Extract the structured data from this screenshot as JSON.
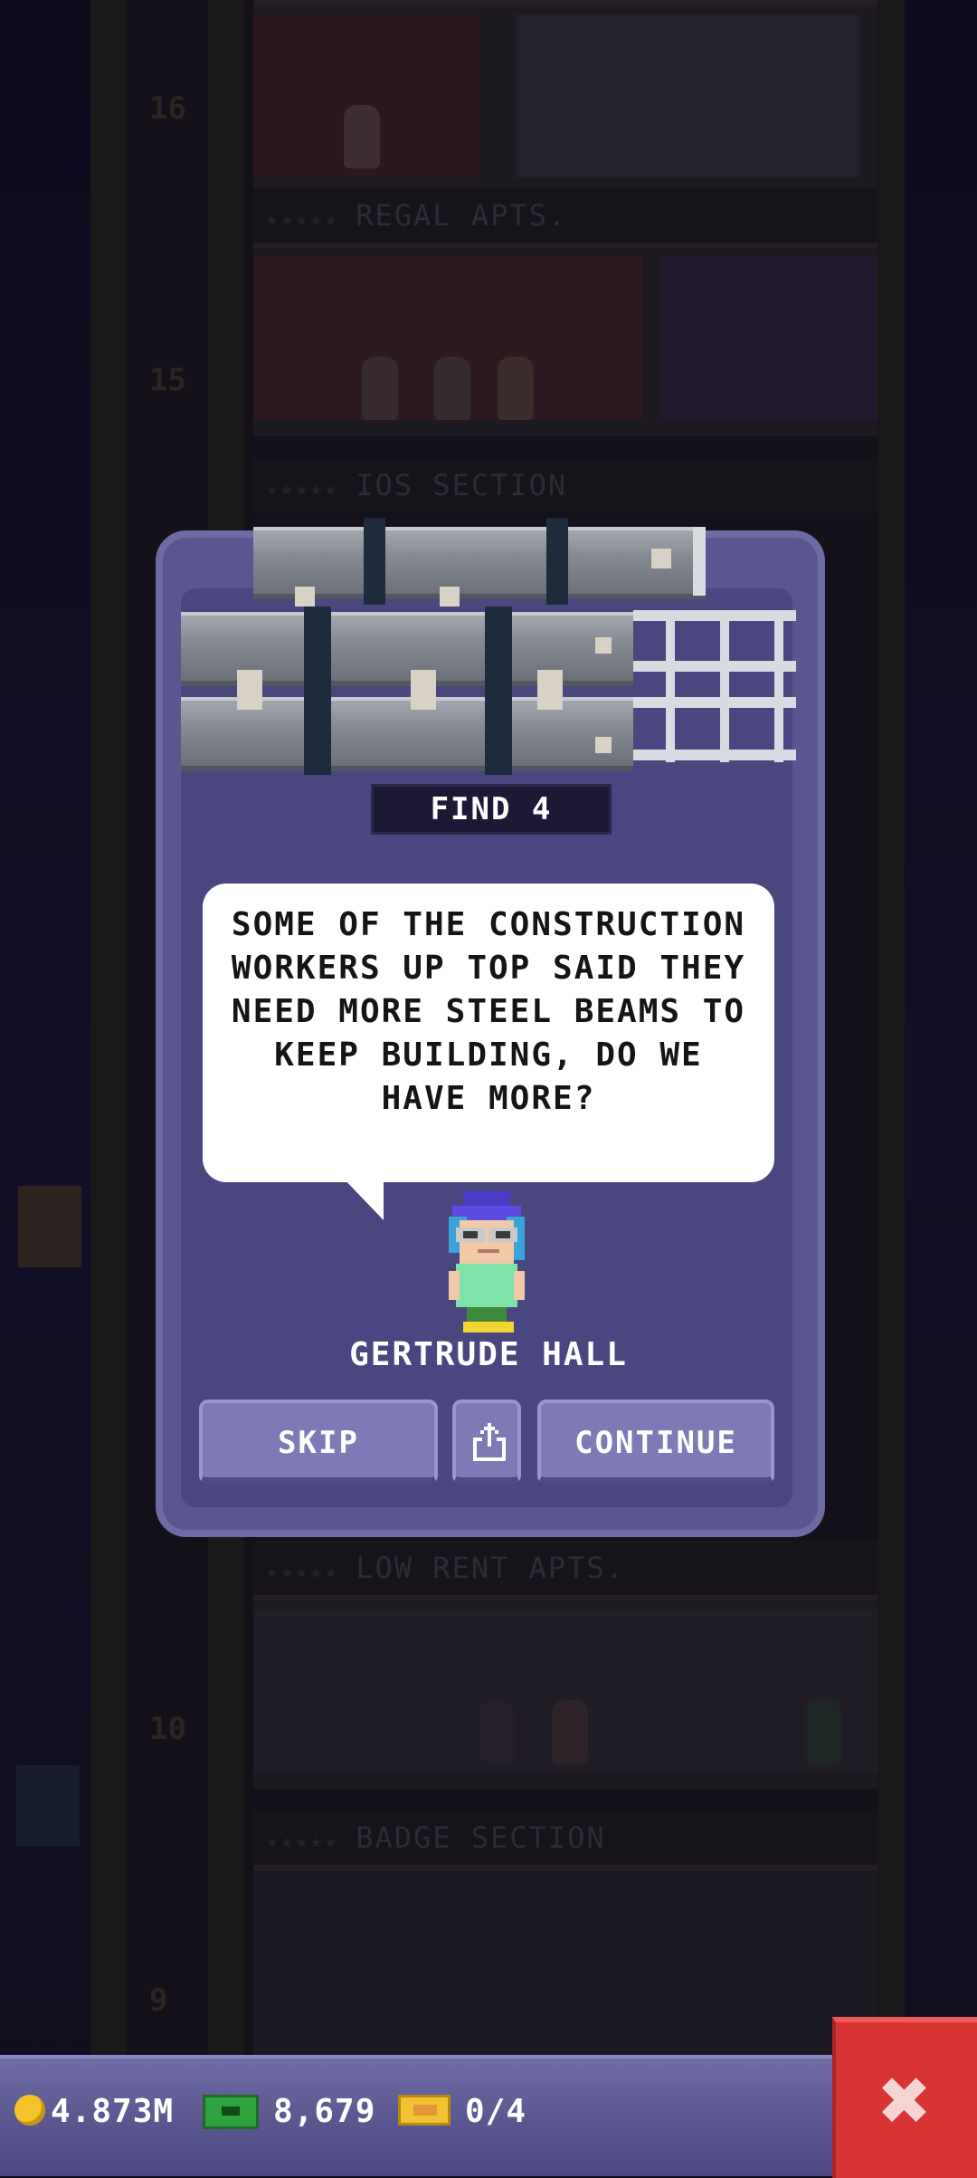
{
  "background": {
    "banners": [
      "REGAL APTS.",
      "IOS SECTION",
      "LOW RENT APTS.",
      "BADGE SECTION"
    ],
    "floor_numbers": [
      "16",
      "15",
      "10",
      "9"
    ]
  },
  "dialog": {
    "badge": "FIND 4",
    "message": "SOME OF THE CONSTRUCTION WORKERS UP TOP SAID THEY NEED MORE STEEL BEAMS TO KEEP BUILDING, DO WE HAVE MORE?",
    "character_name": "GERTRUDE HALL",
    "buttons": {
      "skip": "SKIP",
      "continue": "CONTINUE"
    }
  },
  "bottom_bar": {
    "coins": "4.873M",
    "bux": "8,679",
    "tickets": "0/4"
  },
  "colors": {
    "modal": "#5a568f",
    "button": "#7d7ab6",
    "close": "#d83434",
    "coin": "#f3c42a",
    "bux": "#2ea23c"
  },
  "icons": {
    "share": "share-icon",
    "close": "close-icon",
    "coin": "coin-icon",
    "bux": "bux-icon",
    "ticket": "ticket-icon",
    "beams": "steel-beams-icon"
  }
}
